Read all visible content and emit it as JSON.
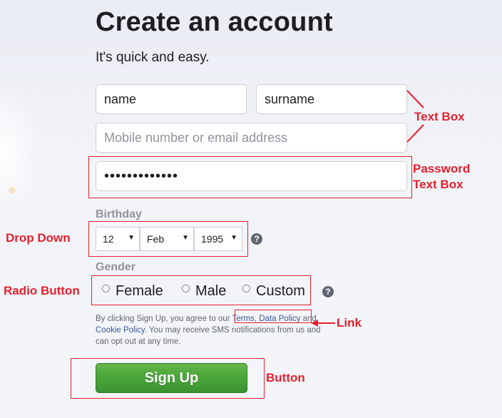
{
  "page": {
    "title": "Create an account",
    "subtitle": "It's quick and easy."
  },
  "form": {
    "first_name_value": "name",
    "surname_value": "surname",
    "contact_placeholder": "Mobile number or email address",
    "password_value": "•••••••••••••",
    "birthday_label": "Birthday",
    "birthday": {
      "day": "12",
      "month": "Feb",
      "year": "1995"
    },
    "gender_label": "Gender",
    "gender_options": [
      "Female",
      "Male",
      "Custom"
    ],
    "help_glyph": "?",
    "terms": {
      "prefix": "By clicking Sign Up, you agree to our ",
      "terms_link": "Terms",
      "separator": ", ",
      "data_policy_link": "Data Policy",
      "and": " and ",
      "cookie_policy_link": "Cookie Policy",
      "suffix": ". You may receive SMS notifications from us and can opt out at any time."
    },
    "signup_label": "Sign Up"
  },
  "annotations": {
    "text_box": "Text Box",
    "password_text_box_line1": "Password",
    "password_text_box_line2": "Text Box",
    "drop_down": "Drop Down",
    "radio_button": "Radio Button",
    "link": "Link",
    "button": "Button"
  },
  "colors": {
    "annotation": "#e5202e",
    "link": "#385898",
    "signup_green": "#4aa63a"
  }
}
